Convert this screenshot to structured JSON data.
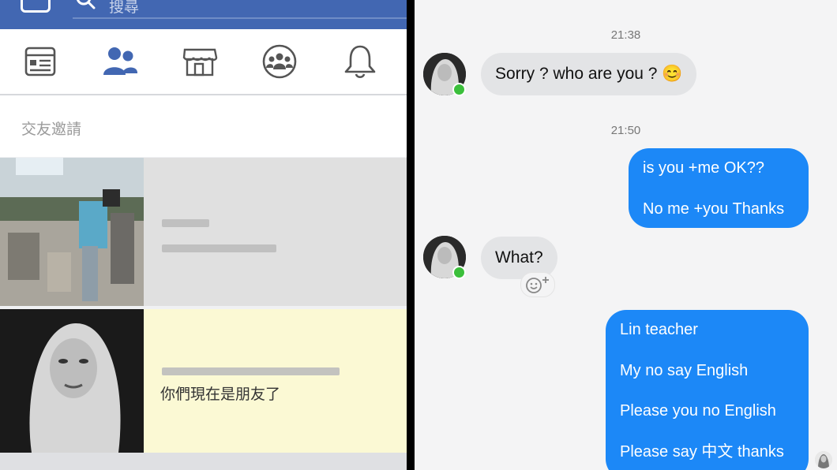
{
  "facebook": {
    "search_placeholder": "搜尋",
    "nav_icons": [
      "news-feed-icon",
      "friends-icon",
      "marketplace-icon",
      "groups-icon",
      "notifications-icon"
    ],
    "section_title": "交友邀請",
    "requests": [
      {
        "status": ""
      },
      {
        "status": "你們現在是朋友了"
      }
    ],
    "colors": {
      "header": "#4267b2",
      "active_icon": "#4267b2",
      "accepted_row": "#fbf9d4"
    }
  },
  "messenger": {
    "messages": [
      {
        "timestamp": "21:38"
      },
      {
        "sender": "incoming",
        "text": "Sorry ? who are you ? 😊"
      },
      {
        "timestamp": "21:50"
      },
      {
        "sender": "outgoing",
        "lines": [
          "is you +me OK??",
          "No me +you Thanks"
        ]
      },
      {
        "sender": "incoming",
        "text": "What?"
      },
      {
        "sender": "outgoing",
        "lines": [
          "Lin teacher",
          "My no say English",
          "Please you no English",
          "Please say 中文 thanks"
        ]
      }
    ],
    "colors": {
      "outgoing": "#1c88f7",
      "incoming": "#e3e4e6",
      "online": "#3bbf3b"
    }
  }
}
